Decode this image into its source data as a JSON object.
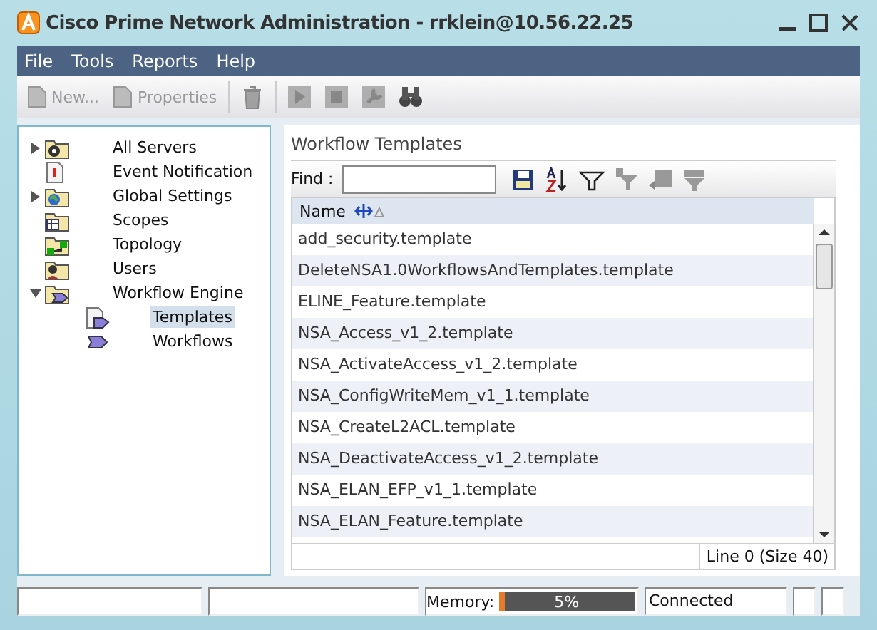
{
  "window": {
    "title": "Cisco Prime Network Administration - rrklein@10.56.22.25"
  },
  "menu": [
    "File",
    "Tools",
    "Reports",
    "Help"
  ],
  "toolbar": [
    {
      "kind": "text",
      "label": "New...",
      "disabled": true
    },
    {
      "kind": "text",
      "label": "Properties",
      "disabled": true
    },
    {
      "kind": "trash",
      "disabled": true
    },
    {
      "kind": "play",
      "disabled": true
    },
    {
      "kind": "stop",
      "disabled": true
    },
    {
      "kind": "wrench",
      "disabled": true
    },
    {
      "kind": "binoculars",
      "disabled": false
    }
  ],
  "tree": [
    {
      "label": "All Servers",
      "expanded": false,
      "selected": false
    },
    {
      "label": "Event Notification",
      "selected": false
    },
    {
      "label": "Global Settings",
      "expanded": false,
      "selected": false
    },
    {
      "label": "Scopes",
      "selected": false
    },
    {
      "label": "Topology",
      "selected": false
    },
    {
      "label": "Users",
      "selected": false
    },
    {
      "label": "Workflow Engine",
      "expanded": true,
      "selected": false,
      "children": [
        {
          "label": "Templates",
          "selected": true
        },
        {
          "label": "Workflows",
          "selected": false
        }
      ]
    }
  ],
  "panel": {
    "title": "Workflow Templates",
    "find_label": "Find :"
  },
  "table": {
    "columns": [
      "Name"
    ],
    "rows": [
      "add_security.template",
      "DeleteNSA1.0WorkflowsAndTemplates.template",
      "ELINE_Feature.template",
      "NSA_Access_v1_2.template",
      "NSA_ActivateAccess_v1_2.template",
      "NSA_ConfigWriteMem_v1_1.template",
      "NSA_CreateL2ACL.template",
      "NSA_DeactivateAccess_v1_2.template",
      "NSA_ELAN_EFP_v1_1.template",
      "NSA_ELAN_Feature.template"
    ],
    "footer": "Line 0 (Size 40)"
  },
  "status_bar": {
    "memory_label": "Memory:",
    "memory": {
      "level": 0.05,
      "reading": "5%"
    },
    "connection": "Connected"
  }
}
